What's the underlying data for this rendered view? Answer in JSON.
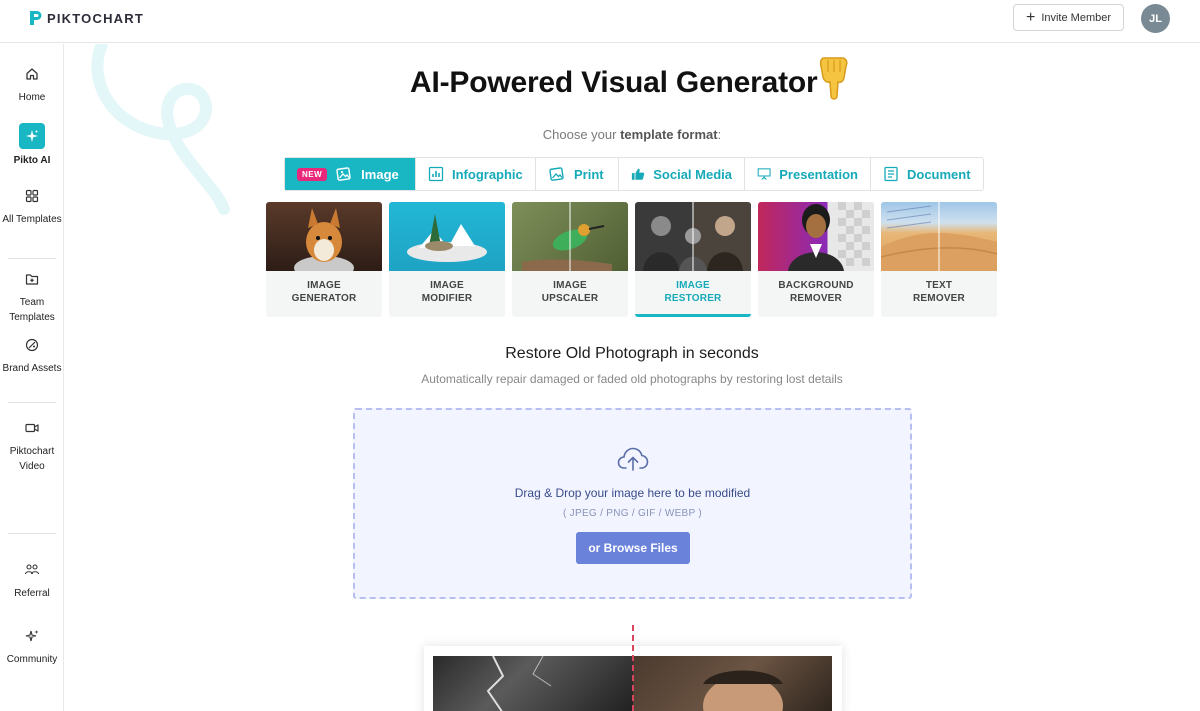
{
  "app": {
    "brand": "PIKTOCHART",
    "brand_color": "#19b6c4"
  },
  "header": {
    "invite_label": "Invite Member",
    "avatar_initials": "JL"
  },
  "sidebar": {
    "items": [
      {
        "label": "Home",
        "icon": "home-icon"
      },
      {
        "label": "Pikto AI",
        "icon": "sparkle-icon",
        "active": true
      },
      {
        "label": "All Templates",
        "icon": "grid-icon"
      },
      {
        "label": "Team Templates",
        "icon": "folder-plus-icon"
      },
      {
        "label": "Brand Assets",
        "icon": "palette-icon"
      },
      {
        "label": "Piktochart Video",
        "icon": "video-icon"
      },
      {
        "label": "Referral",
        "icon": "people-icon"
      },
      {
        "label": "Community",
        "icon": "sparkle-icon"
      }
    ]
  },
  "main": {
    "headline": "AI-Powered Visual Generator",
    "choose_prefix": "Choose your ",
    "choose_bold": "template format",
    "choose_suffix": ":",
    "tabs": [
      {
        "label": "Image",
        "badge": "NEW",
        "active": true,
        "icon": "image-icon"
      },
      {
        "label": "Infographic",
        "icon": "bar-chart-icon"
      },
      {
        "label": "Print",
        "icon": "print-icon"
      },
      {
        "label": "Social Media",
        "icon": "thumbs-up-icon"
      },
      {
        "label": "Presentation",
        "icon": "presentation-icon"
      },
      {
        "label": "Document",
        "icon": "document-icon"
      }
    ],
    "tools": [
      {
        "line1": "IMAGE",
        "line2": "GENERATOR"
      },
      {
        "line1": "IMAGE",
        "line2": "MODIFIER"
      },
      {
        "line1": "IMAGE",
        "line2": "UPSCALER"
      },
      {
        "line1": "IMAGE",
        "line2": "RESTORER",
        "active": true
      },
      {
        "line1": "BACKGROUND",
        "line2": "REMOVER"
      },
      {
        "line1": "TEXT",
        "line2": "REMOVER"
      }
    ],
    "section_title": "Restore Old Photograph in seconds",
    "section_subtitle": "Automatically repair damaged or faded old photographs by restoring lost details",
    "dropzone": {
      "text": "Drag & Drop your image here to be modified",
      "formats": "( JPEG / PNG / GIF / WEBP )",
      "browse_label": "or Browse Files"
    }
  }
}
